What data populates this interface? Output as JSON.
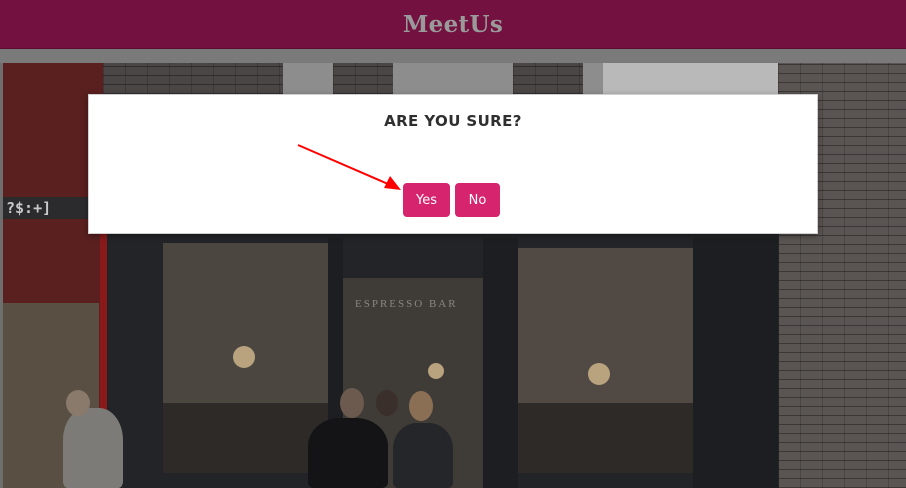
{
  "header": {
    "title": "MeetUs"
  },
  "background": {
    "sign_text": "?$:+]",
    "storefront_text": "ESPRESSO BAR"
  },
  "dialog": {
    "title": "ARE YOU SURE?",
    "yes_label": "Yes",
    "no_label": "No"
  },
  "annotation": {
    "arrow_color": "#ff0000",
    "target": "yes-button"
  },
  "colors": {
    "header_bg": "#731140",
    "header_text": "#9a9a9a",
    "button_bg": "#d6246e",
    "button_text": "#ffffff",
    "dialog_bg": "#ffffff"
  }
}
